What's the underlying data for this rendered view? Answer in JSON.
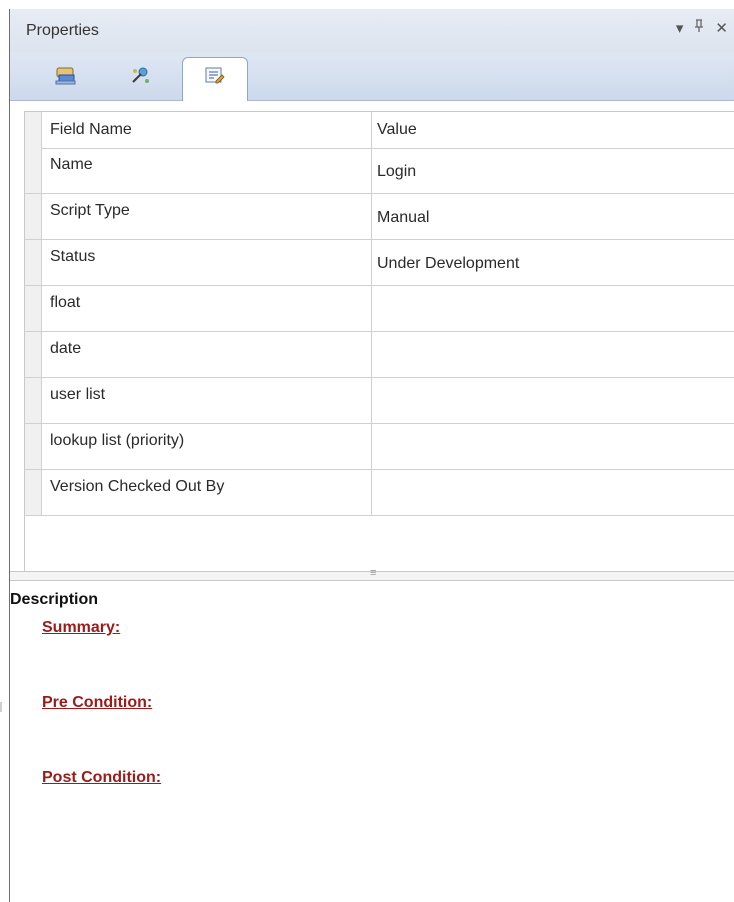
{
  "panel": {
    "title": "Properties",
    "controls": {
      "dropdown": "▾",
      "pin": "⊥",
      "close": "✕"
    }
  },
  "toolbar": {
    "buttons": [
      {
        "icon": "details-icon"
      },
      {
        "icon": "wizard-icon"
      },
      {
        "icon": "memo-edit-icon",
        "active": true
      }
    ]
  },
  "grid": {
    "headers": {
      "field": "Field Name",
      "value": "Value"
    },
    "rows": [
      {
        "field": "Name",
        "value": "Login"
      },
      {
        "field": "Script Type",
        "value": "Manual"
      },
      {
        "field": "Status",
        "value": "Under Development"
      },
      {
        "field": "float",
        "value": ""
      },
      {
        "field": "date",
        "value": ""
      },
      {
        "field": "user list",
        "value": ""
      },
      {
        "field": "lookup list  (priority)",
        "value": ""
      },
      {
        "field": "Version Checked Out By",
        "value": ""
      }
    ]
  },
  "description": {
    "title": "Description",
    "summary": "Summary:",
    "pre_condition": "Pre Condition:",
    "post_condition": "Post Condition:"
  }
}
